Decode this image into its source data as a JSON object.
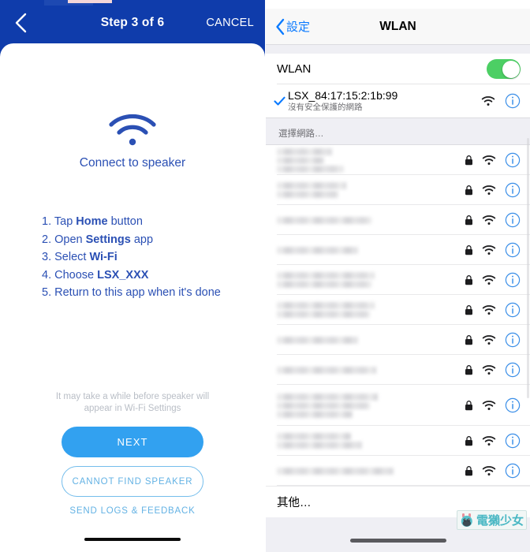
{
  "left": {
    "header": {
      "back_icon": "chevron-left-icon",
      "title": "Step 3 of 6",
      "cancel_label": "CANCEL",
      "bg_color": "#0f3cab"
    },
    "hero": {
      "icon": "wifi-icon",
      "title": "Connect to speaker",
      "title_color": "#2b50b4"
    },
    "steps": [
      {
        "num": "1.",
        "pre": "Tap ",
        "bold": "Home",
        "post": " button"
      },
      {
        "num": "2.",
        "pre": "Open ",
        "bold": "Settings",
        "post": " app"
      },
      {
        "num": "3.",
        "pre": "Select ",
        "bold": "Wi-Fi",
        "post": ""
      },
      {
        "num": "4.",
        "pre": "Choose ",
        "bold": "LSX_XXX",
        "post": ""
      },
      {
        "num": "5.",
        "pre": "Return to this app when it's done",
        "bold": "",
        "post": ""
      }
    ],
    "note": "It may take a while before speaker will appear in Wi-Fi Settings",
    "next_label": "NEXT",
    "next_color": "#32a1f0",
    "cannot_find_label": "CANNOT FIND SPEAKER",
    "send_logs_label": "SEND LOGS & FEEDBACK",
    "link_color": "#63b2e4"
  },
  "right": {
    "header": {
      "back_icon": "chevron-left-icon",
      "back_label": "設定",
      "title": "WLAN",
      "tint_color": "#0a7aff"
    },
    "wlan_row": {
      "label": "WLAN",
      "toggle_state": "on",
      "toggle_color": "#4ccf64"
    },
    "current_network": {
      "check_icon": "checkmark-icon",
      "ssid": "LSX_84:17:15:2:1b:99",
      "subtitle": "沒有安全保護的網路",
      "wifi_icon": "wifi-icon",
      "info_icon": "info-circle-icon"
    },
    "section_header": "選擇網路…",
    "networks": [
      {
        "name_hidden": true,
        "widths": [
          70,
          60,
          85
        ],
        "lock_icon": "lock-icon",
        "wifi_icon": "wifi-icon",
        "info_icon": "info-circle-icon"
      },
      {
        "name_hidden": true,
        "widths": [
          88,
          78
        ],
        "lock_icon": "lock-icon",
        "wifi_icon": "wifi-icon",
        "info_icon": "info-circle-icon"
      },
      {
        "name_hidden": true,
        "widths": [
          120
        ],
        "lock_icon": "lock-icon",
        "wifi_icon": "wifi-icon",
        "info_icon": "info-circle-icon"
      },
      {
        "name_hidden": true,
        "widths": [
          103
        ],
        "lock_icon": "lock-icon",
        "wifi_icon": "wifi-icon",
        "info_icon": "info-circle-icon"
      },
      {
        "name_hidden": true,
        "widths": [
          124,
          120
        ],
        "lock_icon": "lock-icon",
        "wifi_icon": "wifi-icon",
        "info_icon": "info-circle-icon"
      },
      {
        "name_hidden": true,
        "widths": [
          124,
          118
        ],
        "lock_icon": "lock-icon",
        "wifi_icon": "wifi-icon",
        "info_icon": "info-circle-icon"
      },
      {
        "name_hidden": true,
        "widths": [
          103
        ],
        "lock_icon": "lock-icon",
        "wifi_icon": "wifi-icon",
        "info_icon": "info-circle-icon"
      },
      {
        "name_hidden": true,
        "widths": [
          126
        ],
        "lock_icon": "lock-icon",
        "wifi_icon": "wifi-icon",
        "info_icon": "info-circle-icon"
      },
      {
        "name_hidden": true,
        "widths": [
          128,
          118,
          96
        ],
        "lock_icon": "lock-icon",
        "wifi_icon": "wifi-icon",
        "info_icon": "info-circle-icon"
      },
      {
        "name_hidden": true,
        "widths": [
          94,
          108
        ],
        "lock_icon": "lock-icon",
        "wifi_icon": "wifi-icon",
        "info_icon": "info-circle-icon"
      },
      {
        "name_hidden": true,
        "widths": [
          148
        ],
        "lock_icon": "lock-icon",
        "wifi_icon": "wifi-icon",
        "info_icon": "info-circle-icon"
      }
    ],
    "other_label": "其他…"
  },
  "watermark": {
    "text": "電獺少女",
    "color": "#4ab8c4",
    "mascot_icon": "mascot-icon"
  }
}
